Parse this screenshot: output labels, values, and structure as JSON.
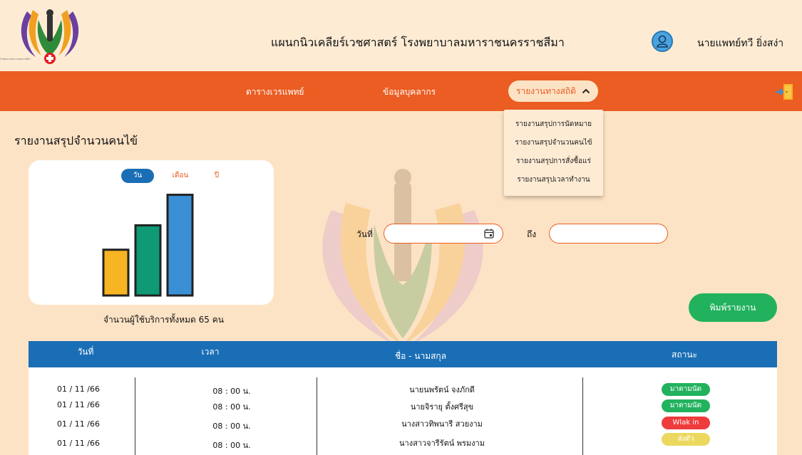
{
  "header": {
    "title": "แผนกนิวเคลียร์เวชศาสตร์ โรงพยาบาลมหาราชนครราชสีมา",
    "user_name": "นายแพทย์ทวี ยิ่งสง่า",
    "logo_caption": "โรงพยาบาลมหาราชนครราชสีมา"
  },
  "nav": {
    "items": [
      "ตารางเวรแพทย์",
      "ข้อมูลบุคลากร"
    ],
    "active_label": "รายงานทางสถิติ",
    "active_icon": "chevron-up-icon",
    "logout_icon": "logout-icon"
  },
  "dropdown": {
    "items": [
      "รายงานสรุปการนัดหมาย",
      "รายงานสรุปจำนวนคนไข้",
      "รายงานสรุปการสั่งซื้อแร่",
      "รายงานสรุปเวลาทำงาน"
    ]
  },
  "page": {
    "title": "รายงานสรุปจำนวนคนไข้"
  },
  "chart": {
    "tabs": [
      "วัน",
      "เดือน",
      "ปี"
    ],
    "active_tab": "วัน",
    "total_text": "จำนวนผู้ใช้บริการทั้งหมด 65 คน"
  },
  "chart_data": {
    "type": "bar",
    "categories": [
      "",
      "",
      ""
    ],
    "values": [
      15,
      23,
      33
    ],
    "colors": [
      "#f7b423",
      "#0f9974",
      "#3b8fd4"
    ],
    "title": "",
    "xlabel": "",
    "ylabel": "",
    "ylim": [
      0,
      35
    ],
    "grid": false
  },
  "filter": {
    "date_label": "วันที่",
    "to_label": "ถึง",
    "date_from_value": "",
    "date_to_value": "",
    "print_label": "พิมพ์รายงาน"
  },
  "table": {
    "headers": [
      "วันที่",
      "เวลา",
      "ชื่อ - นามสกุล",
      "สถานะ"
    ],
    "rows": [
      {
        "date": "01 / 11 /66",
        "time": "08 : 00 น.",
        "name": "นายนพรัตน์ จงภักดี",
        "status": "มาตามนัด",
        "status_color": "#22b25e"
      },
      {
        "date": "01 / 11 /66",
        "time": "08 : 00 น.",
        "name": "นายจิรายุ ตั้งศรีสุข",
        "status": "มาตามนัด",
        "status_color": "#22b25e"
      },
      {
        "date": "01 / 11 /66",
        "time": "08 : 00 น.",
        "name": "นางสาวทิพนารี สวยงาม",
        "status": "Wlak in",
        "status_color": "#ee3b3b"
      },
      {
        "date": "01 / 11 /66",
        "time": "08 : 00 น.",
        "name": "นางสาวจารีรัตน์ พรมงาม",
        "status": "ส่งตัว",
        "status_color": "#ecd85e"
      }
    ]
  }
}
